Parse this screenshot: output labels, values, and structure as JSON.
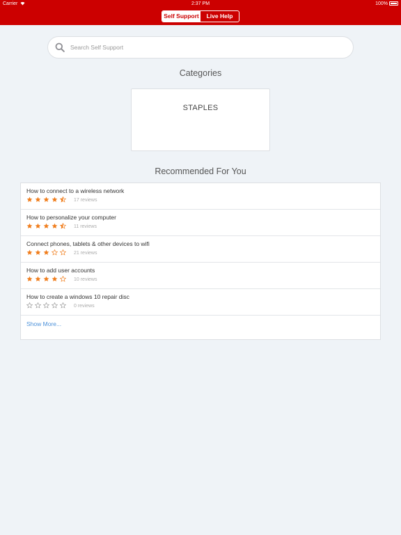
{
  "status_bar": {
    "carrier": "Carrier",
    "time": "2:37 PM",
    "battery": "100%"
  },
  "header": {
    "tabs": [
      {
        "label": "Self Support",
        "active": true
      },
      {
        "label": "Live Help",
        "active": false
      }
    ],
    "bar_color": "#cc0000"
  },
  "search": {
    "placeholder": "Search Self Support",
    "value": ""
  },
  "categories": {
    "title": "Categories",
    "items": [
      {
        "label": "STAPLES"
      }
    ]
  },
  "recommended": {
    "title": "Recommended For You",
    "items": [
      {
        "title": "How to connect to a wireless network",
        "rating": 4.5,
        "reviews": "17 reviews"
      },
      {
        "title": "How to personalize your computer",
        "rating": 4.5,
        "reviews": "11 reviews"
      },
      {
        "title": "Connect phones, tablets & other devices to wifi",
        "rating": 3,
        "reviews": "21 reviews"
      },
      {
        "title": "How to add user accounts",
        "rating": 4,
        "reviews": "10 reviews"
      },
      {
        "title": "How to create a windows 10 repair disc",
        "rating": 0,
        "reviews": "0 reviews"
      }
    ],
    "show_more": "Show More...",
    "star_color": "#f07d1c",
    "star_empty_color": "#999999"
  }
}
